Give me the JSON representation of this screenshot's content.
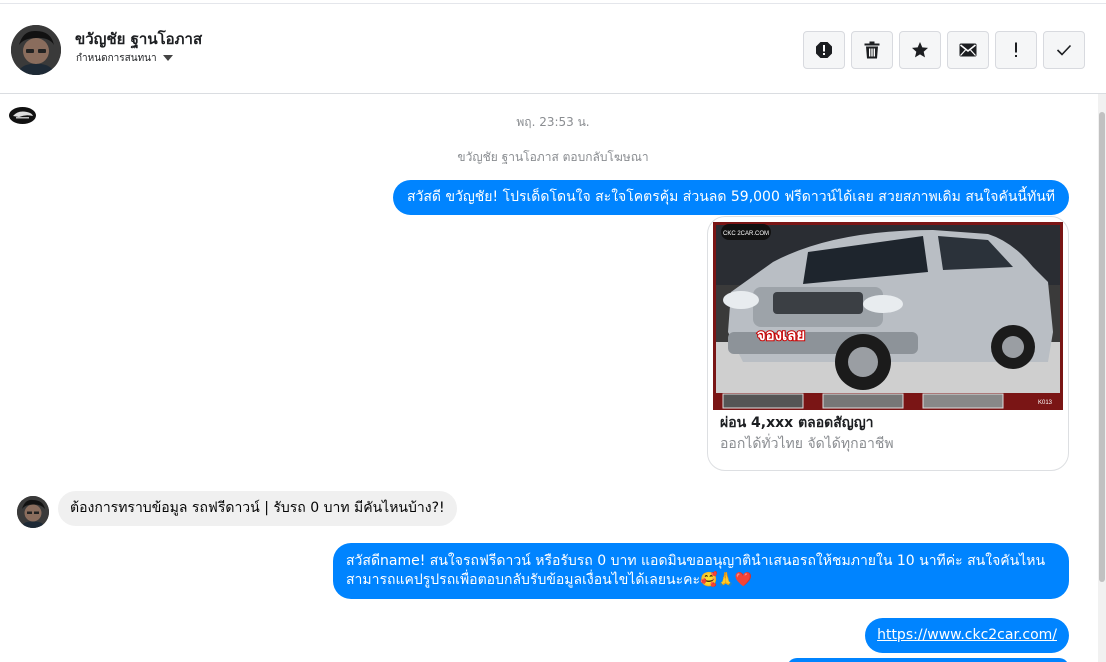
{
  "conversation": {
    "contact_name": "ขวัญชัย ฐานโอภาส",
    "assign_label": "กำหนดการสนทนา",
    "actions": [
      {
        "name": "report-icon"
      },
      {
        "name": "trash-icon"
      },
      {
        "name": "star-icon"
      },
      {
        "name": "mail-icon"
      },
      {
        "name": "important-icon"
      },
      {
        "name": "check-icon"
      }
    ]
  },
  "thread": {
    "timestamp": "พฤ. 23:53 น.",
    "system_note": "ขวัญชัย ฐานโอภาส ตอบกลับโฆษณา",
    "msg_out_1": "สวัสดี ขวัญชัย! โปรเด็ดโดนใจ สะใจโคตรคุ้ม ส่วนลด 59,000 ฟรีดาวน์ได้เลย สวยสภาพเดิม สนใจคันนี้ทันที",
    "card": {
      "image_stamp": "จองเลย",
      "image_watermark": "CKC 2CAR.COM",
      "image_code": "K013",
      "title": "ผ่อน 4,xxx ตลอดสัญญา",
      "subtitle": "ออกได้ทั่วไทย จัดได้ทุกอาชีพ"
    },
    "msg_in_1": "ต้องการทราบข้อมูล รถฟรีดาวน์ | รับรถ 0 บาท มีคันไหนบ้าง?!",
    "msg_out_2": "สวัสดีname! สนใจรถฟรีดาวน์ หรือรับรถ 0 บาท แอดมินขออนุญาตินำเสนอรถให้ชมภายใน 10 นาทีค่ะ สนใจคันไหนสามารถแคปรูปรถเพื่อตอบกลับรับข้อมูลเงื่อนไขได้เลยนะคะ",
    "msg_out_2_emoji": "🥰🙏❤️",
    "msg_out_3_link": "https://www.ckc2car.com/"
  },
  "colors": {
    "outgoing_bubble": "#0084ff",
    "incoming_bubble": "#f0f0f0",
    "secondary_text": "#8a8d91"
  }
}
